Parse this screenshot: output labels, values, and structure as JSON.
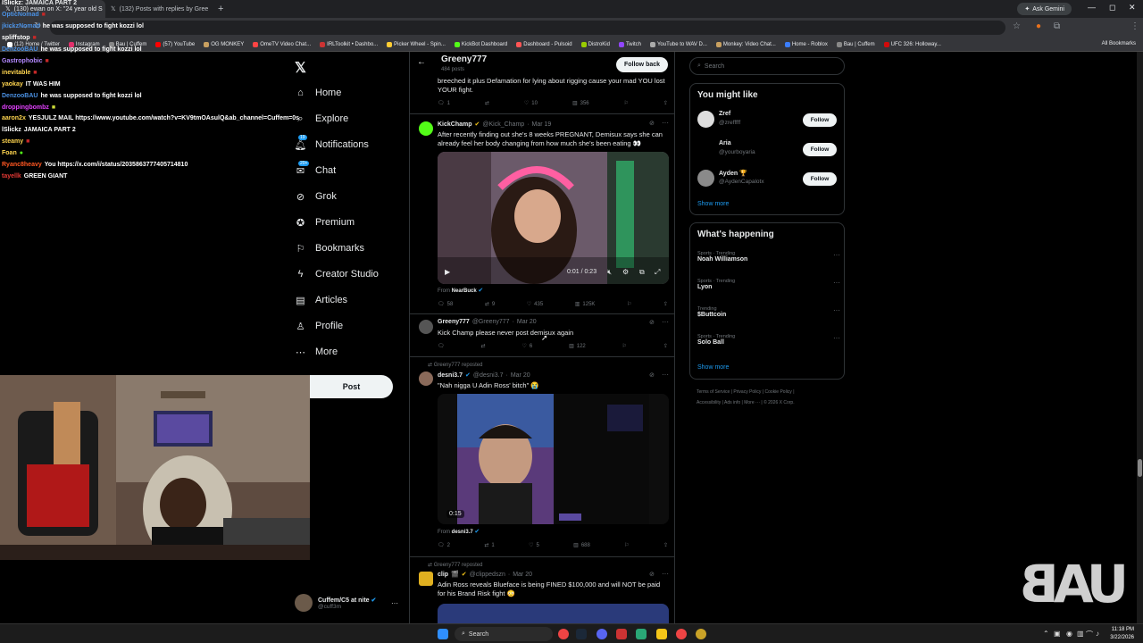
{
  "browser": {
    "tabs": [
      {
        "title": "(130) ewan on X: \"24 year old S",
        "active": true
      },
      {
        "title": "(132) Posts with replies by Gree",
        "active": false
      }
    ],
    "new_tab": "+",
    "gemini_label": "Ask Gemini",
    "bookmarks": [
      "(12) Home / Twitter",
      "Instagram",
      "Bau | Cuffem",
      "(57) YouTube",
      "OG MONKEY",
      "OmeTV Video Chat...",
      "IRLToolkit • Dashbo...",
      "Picker Wheel - Spin...",
      "KickBot Dashboard",
      "Dashboard - Pulsoid",
      "DistroKid",
      "Twitch",
      "YouTube to WAV D...",
      "Monkey: Video Chat...",
      "Home - Roblox",
      "Bau | Cuffem",
      "UFC 326: Holloway..."
    ],
    "all_bookmarks": "All Bookmarks"
  },
  "chat": {
    "top_line": {
      "user": "lSlickz",
      "text": "JAMAICA PART 2"
    },
    "messages": [
      {
        "user": "OpticNomad",
        "text": "■",
        "color": "#4a90e2"
      },
      {
        "user": "jkickzNomad",
        "text": "he was supposed to fight kozzi lol",
        "color": "#4a90e2"
      },
      {
        "user": "spliffstop",
        "text": "■",
        "color": "#ffffff"
      },
      {
        "user": "DenzooBAU",
        "text": "he was supposed to fight kozzi lol",
        "color": "#4a90e2"
      },
      {
        "user": "Gastrophobic",
        "text": "■",
        "color": "#b388ff"
      },
      {
        "user": "inevitable",
        "text": "■",
        "color": "#ffd54f"
      },
      {
        "user": "yaokay",
        "text": "IT WAS HIM",
        "color": "#ffd54f"
      },
      {
        "user": "DenzooBAU",
        "text": "he was supposed to fight kozzi lol",
        "color": "#4a90e2"
      },
      {
        "user": "droppingbombz",
        "text": "■",
        "color": "#e040fb"
      },
      {
        "user": "aaron2x",
        "text": "YESJULZ MAIL https://www.youtube.com/watch?v=KV9tmOAsulQ&ab_channel=Cuffem=0s",
        "color": "#ffd54f"
      },
      {
        "user": "lSlickz",
        "text": "JAMAICA PART 2",
        "color": "#ffffff"
      },
      {
        "user": "steamy",
        "text": "■",
        "color": "#ffd54f"
      },
      {
        "user": "Foan",
        "text": "●",
        "color": "#ffd54f"
      },
      {
        "user": "Ryanc8heavy",
        "text": "You https://x.com/i/status/2035863777405714810",
        "color": "#ff5722"
      },
      {
        "user": "tayellk",
        "text": "GREEN GIANT",
        "color": "#e53935"
      }
    ]
  },
  "nav": {
    "items": [
      {
        "label": "Home",
        "icon": "home-icon"
      },
      {
        "label": "Explore",
        "icon": "search-icon"
      },
      {
        "label": "Notifications",
        "icon": "bell-icon",
        "badge": "19"
      },
      {
        "label": "Chat",
        "icon": "chat-icon",
        "badge": "20+"
      },
      {
        "label": "Grok",
        "icon": "grok-icon"
      },
      {
        "label": "Premium",
        "icon": "premium-icon"
      },
      {
        "label": "Bookmarks",
        "icon": "bookmark-icon"
      },
      {
        "label": "Creator Studio",
        "icon": "bolt-icon"
      },
      {
        "label": "Articles",
        "icon": "article-icon"
      },
      {
        "label": "Profile",
        "icon": "person-icon"
      },
      {
        "label": "More",
        "icon": "more-circle-icon"
      }
    ],
    "post_label": "Post",
    "account": {
      "name": "Cuffem/C5 at nite",
      "handle": "@cuff3m"
    }
  },
  "timeline": {
    "header": {
      "name": "Greeny777",
      "posts": "484 posts",
      "follow_back": "Follow back"
    },
    "top_post": {
      "text": "breeched it plus Defamation for lying about rigging cause your mad YOU lost YOUR fight.",
      "replies": "1",
      "reposts": "",
      "likes": "10",
      "views": "356"
    },
    "posts": [
      {
        "name": "KickChamp",
        "handle": "@Kick_Champ",
        "date": "Mar 19",
        "text": "After recently finding out she's 8 weeks PREGNANT, Demisux says she can already feel her body changing from how much she's been eating 👀",
        "video_time": "0:01 / 0:23",
        "from_label": "From",
        "from_name": "NearBuck",
        "replies": "58",
        "reposts": "9",
        "likes": "435",
        "views": "125K"
      },
      {
        "name": "Greeny777",
        "handle": "@Greeny777",
        "date": "Mar 20",
        "text": "Kick Champ please never post demisux again",
        "replies": "",
        "reposts": "",
        "likes": "6",
        "views": "122"
      },
      {
        "repost_label": "Greeny777 reposted",
        "name": "desni3.7",
        "handle": "@desni3.7",
        "date": "Mar 20",
        "text": "\"Nah nigga U Adin Ross' bitch\" 😭",
        "video_time": "0:15",
        "from_label": "From",
        "from_name": "desni3.7",
        "replies": "2",
        "reposts": "1",
        "likes": "5",
        "views": "688"
      },
      {
        "repost_label": "Greeny777 reposted",
        "name": "clip",
        "handle": "@clippedszn",
        "date": "Mar 20",
        "text": "Adin Ross reveals Blueface is being FINED $100,000 and will NOT be paid for his Brand Risk fight 😳"
      }
    ]
  },
  "sidebar": {
    "search_placeholder": "Search",
    "you_might_like": {
      "title": "You might like",
      "users": [
        {
          "name": "Zref",
          "handle": "@zrefffff"
        },
        {
          "name": "Aria",
          "handle": "@yourboyaria"
        },
        {
          "name": "Ayden 🏆",
          "handle": "@AydenCapalotx"
        }
      ],
      "follow_label": "Follow",
      "show_more": "Show more"
    },
    "whats_happening": {
      "title": "What's happening",
      "trends": [
        {
          "category": "Sports · Trending",
          "name": "Noah Williamson"
        },
        {
          "category": "Sports · Trending",
          "name": "Lyon"
        },
        {
          "category": "Trending",
          "name": "$Buttcoin"
        },
        {
          "category": "Sports · Trending",
          "name": "Solo Ball"
        }
      ],
      "show_more": "Show more"
    },
    "footer": {
      "links": [
        "Terms of Service",
        "Privacy Policy",
        "Cookie Policy",
        "Accessibility",
        "Ads info",
        "More ···",
        "© 2026 X Corp."
      ]
    }
  },
  "overlay": {
    "logo_text": "UAB"
  },
  "taskbar": {
    "search_label": "Search",
    "time": "11:18 PM",
    "date": "3/22/2026"
  },
  "colors": {
    "accent": "#1d9bf0",
    "background": "#000000",
    "border": "#2f3336"
  }
}
